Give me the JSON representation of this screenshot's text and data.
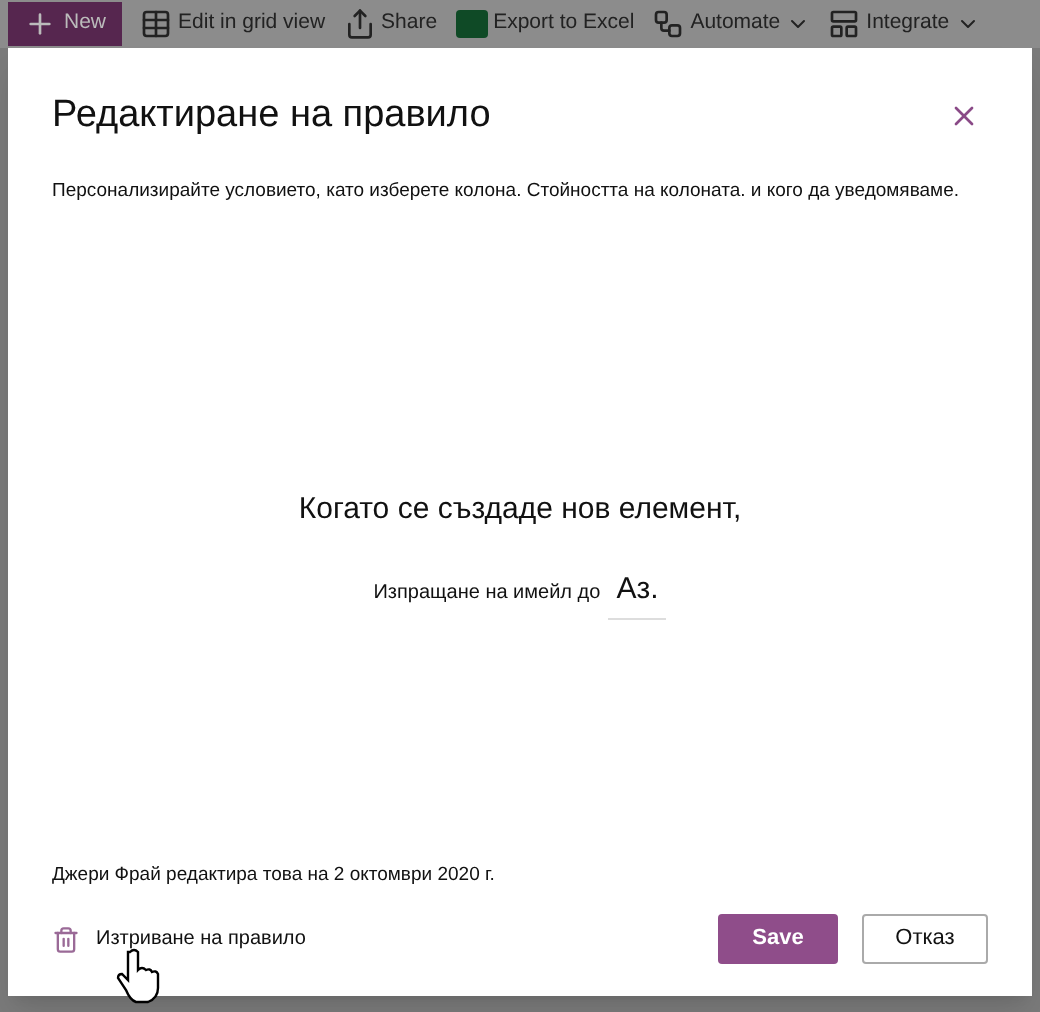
{
  "toolbar": {
    "items": [
      {
        "kind": "new",
        "label": "New"
      },
      {
        "kind": "grid",
        "label": "Edit in grid view"
      },
      {
        "kind": "share",
        "label": "Share"
      },
      {
        "kind": "excel",
        "label": "Export to Excel"
      },
      {
        "kind": "automate",
        "label": "Automate",
        "dropdown": true
      },
      {
        "kind": "integrate",
        "label": "Integrate",
        "dropdown": true
      }
    ]
  },
  "dialog": {
    "title": "Редактиране на правило",
    "description": "Персонализирайте условието, като изберете колона. Стойността на колоната. и кого да уведомяваме.",
    "condition": "Когато се създаде нов елемент,",
    "action_label": "Изпращане на имейл до",
    "action_value": "Аз.",
    "edited_note": "Джери Фрай редактира това на 2 октомври 2020 г.",
    "delete_link": "Изтриване на правило",
    "save_button": "Save",
    "cancel_button": "Отказ"
  }
}
